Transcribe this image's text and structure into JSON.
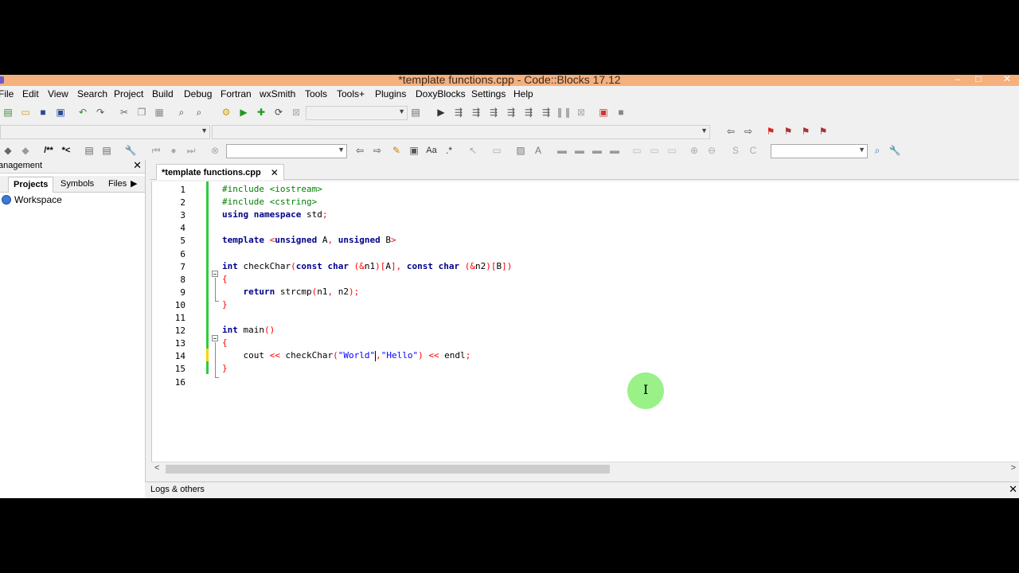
{
  "window": {
    "title": "*template functions.cpp - Code::Blocks 17.12",
    "controls": [
      "–",
      "□",
      "✕"
    ]
  },
  "menu": [
    "File",
    "Edit",
    "View",
    "Search",
    "Project",
    "Build",
    "Debug",
    "Fortran",
    "wxSmith",
    "Tools",
    "Tools+",
    "Plugins",
    "DoxyBlocks",
    "Settings",
    "Help"
  ],
  "toolbar": {
    "doxy_comment": "/**",
    "doxy_line": "*<"
  },
  "management": {
    "title": "anagement",
    "close": "✕",
    "tabs": [
      "Projects",
      "Symbols",
      "Files"
    ],
    "tab_scroll": "▶",
    "tree": [
      "Workspace"
    ]
  },
  "editor": {
    "tab_label": "*template functions.cpp",
    "tab_close": "✕",
    "line_numbers": [
      "1",
      "2",
      "3",
      "4",
      "5",
      "6",
      "7",
      "8",
      "9",
      "10",
      "11",
      "12",
      "13",
      "14",
      "15",
      "16"
    ],
    "lines": [
      [
        {
          "t": "pp",
          "v": "#include <iostream>"
        }
      ],
      [
        {
          "t": "pp",
          "v": "#include <cstring>"
        }
      ],
      [
        {
          "t": "kw",
          "v": "using namespace"
        },
        {
          "t": "plain",
          "v": " std"
        },
        {
          "t": "op",
          "v": ";"
        }
      ],
      [],
      [
        {
          "t": "kw",
          "v": "template"
        },
        {
          "t": "plain",
          "v": " "
        },
        {
          "t": "op",
          "v": "<"
        },
        {
          "t": "kw",
          "v": "unsigned"
        },
        {
          "t": "plain",
          "v": " A"
        },
        {
          "t": "op",
          "v": ","
        },
        {
          "t": "plain",
          "v": " "
        },
        {
          "t": "kw",
          "v": "unsigned"
        },
        {
          "t": "plain",
          "v": " B"
        },
        {
          "t": "op",
          "v": ">"
        }
      ],
      [],
      [
        {
          "t": "kw",
          "v": "int"
        },
        {
          "t": "plain",
          "v": " checkChar"
        },
        {
          "t": "op",
          "v": "("
        },
        {
          "t": "kw",
          "v": "const char"
        },
        {
          "t": "plain",
          "v": " "
        },
        {
          "t": "op",
          "v": "(&"
        },
        {
          "t": "plain",
          "v": "n1"
        },
        {
          "t": "op",
          "v": ")["
        },
        {
          "t": "plain",
          "v": "A"
        },
        {
          "t": "op",
          "v": "],"
        },
        {
          "t": "plain",
          "v": " "
        },
        {
          "t": "kw",
          "v": "const char"
        },
        {
          "t": "plain",
          "v": " "
        },
        {
          "t": "op",
          "v": "(&"
        },
        {
          "t": "plain",
          "v": "n2"
        },
        {
          "t": "op",
          "v": ")["
        },
        {
          "t": "plain",
          "v": "B"
        },
        {
          "t": "op",
          "v": "])"
        }
      ],
      [
        {
          "t": "op",
          "v": "{"
        }
      ],
      [
        {
          "t": "plain",
          "v": "    "
        },
        {
          "t": "kw",
          "v": "return"
        },
        {
          "t": "plain",
          "v": " strcmp"
        },
        {
          "t": "op",
          "v": "("
        },
        {
          "t": "plain",
          "v": "n1"
        },
        {
          "t": "op",
          "v": ","
        },
        {
          "t": "plain",
          "v": " n2"
        },
        {
          "t": "op",
          "v": ");"
        }
      ],
      [
        {
          "t": "op",
          "v": "}"
        }
      ],
      [],
      [
        {
          "t": "kw",
          "v": "int"
        },
        {
          "t": "plain",
          "v": " main"
        },
        {
          "t": "op",
          "v": "()"
        }
      ],
      [
        {
          "t": "op",
          "v": "{"
        }
      ],
      [
        {
          "t": "plain",
          "v": "    cout "
        },
        {
          "t": "op",
          "v": "<<"
        },
        {
          "t": "plain",
          "v": " checkChar"
        },
        {
          "t": "op",
          "v": "("
        },
        {
          "t": "str",
          "v": "\"World\""
        },
        {
          "t": "cursor",
          "v": ""
        },
        {
          "t": "op",
          "v": ","
        },
        {
          "t": "str",
          "v": "\"Hello\""
        },
        {
          "t": "op",
          "v": ")"
        },
        {
          "t": "plain",
          "v": " "
        },
        {
          "t": "op",
          "v": "<<"
        },
        {
          "t": "plain",
          "v": " endl"
        },
        {
          "t": "op",
          "v": ";"
        }
      ],
      [
        {
          "t": "op",
          "v": "}"
        }
      ],
      []
    ]
  },
  "scroll": {
    "left": "<",
    "right": ">"
  },
  "logs": {
    "title": "Logs & others",
    "close": "✕"
  }
}
